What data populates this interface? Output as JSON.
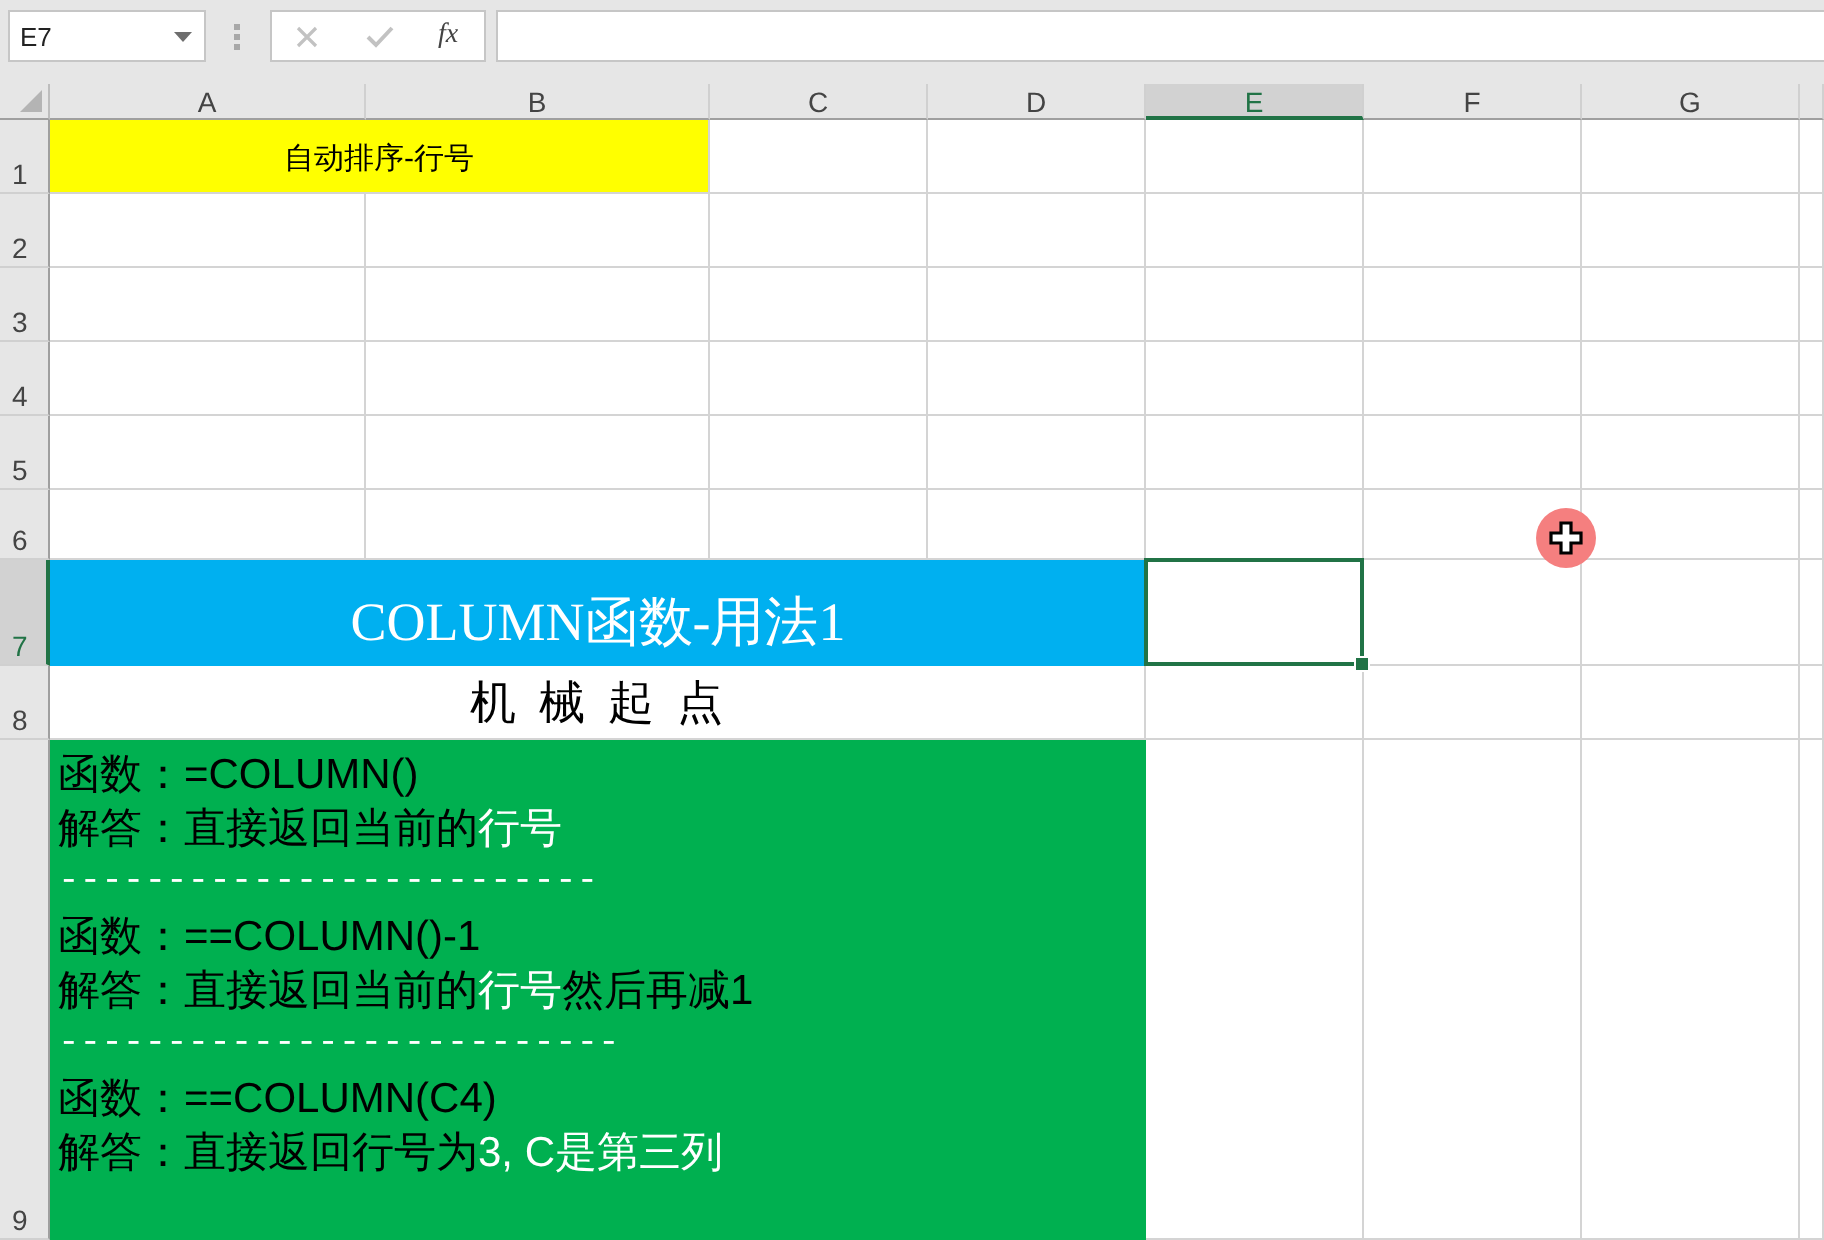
{
  "name_box": {
    "value": "E7"
  },
  "formula_bar": {
    "function_label": "fx"
  },
  "columns": [
    {
      "label": "A",
      "selected": false
    },
    {
      "label": "B",
      "selected": false
    },
    {
      "label": "C",
      "selected": false
    },
    {
      "label": "D",
      "selected": false
    },
    {
      "label": "E",
      "selected": true
    },
    {
      "label": "F",
      "selected": false
    },
    {
      "label": "G",
      "selected": false
    }
  ],
  "rows": [
    {
      "label": "1",
      "selected": false,
      "content": {
        "kind": "caption",
        "text": "自动排序-行号"
      }
    },
    {
      "label": "2",
      "selected": false
    },
    {
      "label": "3",
      "selected": false
    },
    {
      "label": "4",
      "selected": false
    },
    {
      "label": "5",
      "selected": false
    },
    {
      "label": "6",
      "selected": false
    },
    {
      "label": "7",
      "selected": true,
      "content": {
        "kind": "heading",
        "text": "COLUMN函数-用法1"
      }
    },
    {
      "label": "8",
      "selected": false,
      "content": {
        "kind": "subheading",
        "text": "机 械 起 点"
      }
    },
    {
      "label": "9",
      "selected": false,
      "content": {
        "kind": "notes",
        "lines": [
          {
            "kind": "text",
            "segments": [
              {
                "text": "函数：=COLUMN()",
                "highlighted": false
              }
            ]
          },
          {
            "kind": "text",
            "segments": [
              {
                "text": "解答：直接返回当前的",
                "highlighted": false
              },
              {
                "text": "行号",
                "highlighted": true
              }
            ]
          },
          {
            "kind": "separator",
            "segments": [
              {
                "text": "-------------------------",
                "highlighted": true
              }
            ]
          },
          {
            "kind": "text",
            "segments": [
              {
                "text": "函数：==COLUMN()-1",
                "highlighted": false
              }
            ]
          },
          {
            "kind": "text",
            "segments": [
              {
                "text": "解答：直接返回当前的",
                "highlighted": false
              },
              {
                "text": "行号",
                "highlighted": true
              },
              {
                "text": "然后再减1",
                "highlighted": false
              }
            ]
          },
          {
            "kind": "separator",
            "segments": [
              {
                "text": "--------------------------",
                "highlighted": true
              }
            ]
          },
          {
            "kind": "text",
            "segments": [
              {
                "text": "函数：==COLUMN(C4)",
                "highlighted": false
              }
            ]
          },
          {
            "kind": "text",
            "segments": [
              {
                "text": "解答：直接返回行号为",
                "highlighted": false
              },
              {
                "text": "3, C是第三列",
                "highlighted": true
              }
            ]
          }
        ]
      }
    }
  ]
}
